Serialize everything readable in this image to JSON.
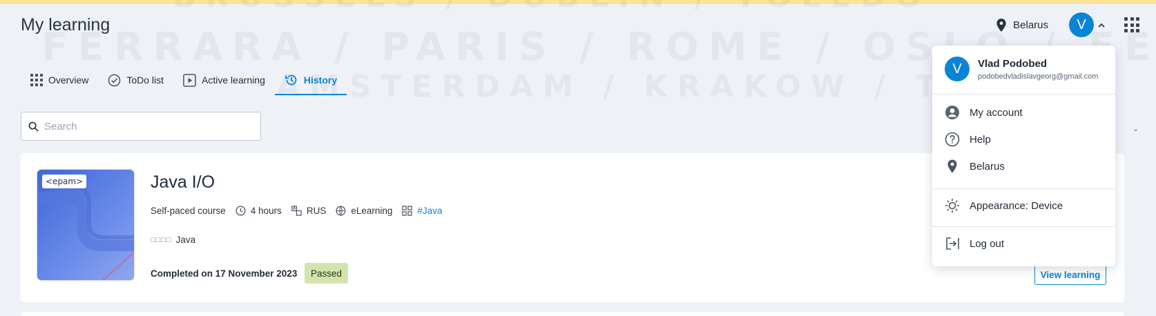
{
  "page": {
    "title": "My learning"
  },
  "background": {
    "watermark_lines": [
      "BRUSSELS / DUBLIN / TOLEDO",
      "FERRARA / PARIS / ROME / OSLO / FERR",
      "AMSTERDAM / KRAKOW / TOK"
    ]
  },
  "header": {
    "location": "Belarus",
    "avatar_initial": "V"
  },
  "tabs": [
    {
      "label": "Overview",
      "icon": "grid-icon"
    },
    {
      "label": "ToDo list",
      "icon": "check-circle-icon"
    },
    {
      "label": "Active learning",
      "icon": "play-icon"
    },
    {
      "label": "History",
      "icon": "history-icon",
      "active": true
    }
  ],
  "search": {
    "placeholder": "Search",
    "value": ""
  },
  "course": {
    "thumb_logo": "<epam>",
    "title": "Java I/O",
    "type": "Self-paced course",
    "duration": "4 hours",
    "language": "RUS",
    "format": "eLearning",
    "tag": "#Java",
    "skill_dots": "□□□□",
    "skill": "Java",
    "completed": "Completed on 17 November 2023",
    "status": "Passed",
    "action": "View learning"
  },
  "dropdown": {
    "user_initial": "V",
    "user_name": "Vlad Podobed",
    "user_email": "podobedvladislavgeorg@gmail.com",
    "items": [
      {
        "label": "My account",
        "icon": "account-icon"
      },
      {
        "label": "Help",
        "icon": "help-icon"
      },
      {
        "label": "Belarus",
        "icon": "location-pin-icon"
      },
      {
        "label": "Appearance: Device",
        "icon": "sun-icon"
      },
      {
        "label": "Log out",
        "icon": "logout-icon"
      }
    ]
  },
  "colors": {
    "accent": "#0a84d6",
    "passed_badge": "#d3e3ae",
    "top_strip": "#fbe49a",
    "background": "#eef2f7"
  }
}
